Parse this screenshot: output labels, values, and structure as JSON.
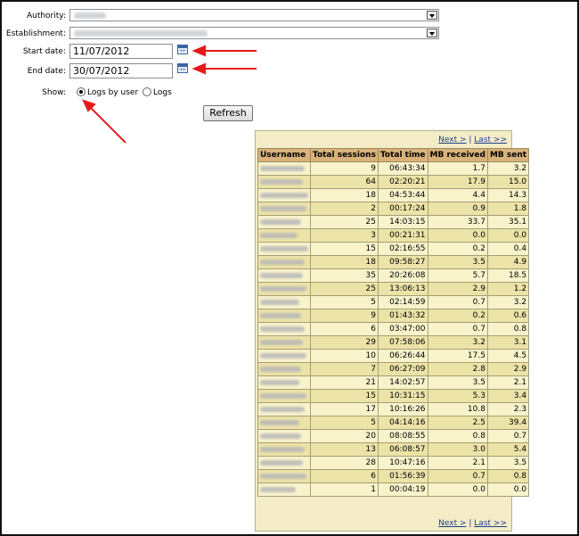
{
  "form": {
    "authority_label": "Authority:",
    "establishment_label": "Establishment:",
    "start_label": "Start date:",
    "start_value": "11/07/2012",
    "end_label": "End date:",
    "end_value": "30/07/2012",
    "show_label": "Show:",
    "opt_by_user": "Logs by user",
    "opt_logs": "Logs",
    "refresh": "Refresh"
  },
  "pager": {
    "next": "Next >",
    "sep": " | ",
    "last": "Last >>"
  },
  "table": {
    "headers": [
      "Username",
      "Total sessions",
      "Total time",
      "MB received",
      "MB sent"
    ],
    "rows": [
      [
        "9",
        "06:43:34",
        "1.7",
        "3.2"
      ],
      [
        "64",
        "02:20:21",
        "17.9",
        "15.0"
      ],
      [
        "18",
        "04:53:44",
        "4.4",
        "14.3"
      ],
      [
        "2",
        "00:17:24",
        "0.9",
        "1.8"
      ],
      [
        "25",
        "14:03:15",
        "33.7",
        "35.1"
      ],
      [
        "3",
        "00:21:31",
        "0.0",
        "0.0"
      ],
      [
        "15",
        "02:16:55",
        "0.2",
        "0.4"
      ],
      [
        "18",
        "09:58:27",
        "3.5",
        "4.9"
      ],
      [
        "35",
        "20:26:08",
        "5.7",
        "18.5"
      ],
      [
        "25",
        "13:06:13",
        "2.9",
        "1.2"
      ],
      [
        "5",
        "02:14:59",
        "0.7",
        "3.2"
      ],
      [
        "9",
        "01:43:32",
        "0.2",
        "0.6"
      ],
      [
        "6",
        "03:47:00",
        "0.7",
        "0.8"
      ],
      [
        "29",
        "07:58:06",
        "3.2",
        "3.1"
      ],
      [
        "10",
        "06:26:44",
        "17.5",
        "4.5"
      ],
      [
        "7",
        "06:27:09",
        "2.8",
        "2.9"
      ],
      [
        "21",
        "14:02:57",
        "3.5",
        "2.1"
      ],
      [
        "15",
        "10:31:15",
        "5.3",
        "3.4"
      ],
      [
        "17",
        "10:16:26",
        "10.8",
        "2.3"
      ],
      [
        "5",
        "04:14:16",
        "2.5",
        "39.4"
      ],
      [
        "20",
        "08:08:55",
        "0.8",
        "0.7"
      ],
      [
        "13",
        "06:08:57",
        "3.0",
        "5.4"
      ],
      [
        "28",
        "10:47:16",
        "2.1",
        "3.5"
      ],
      [
        "6",
        "01:56:39",
        "0.7",
        "0.8"
      ],
      [
        "1",
        "00:04:19",
        "0.0",
        "0.0"
      ]
    ]
  }
}
